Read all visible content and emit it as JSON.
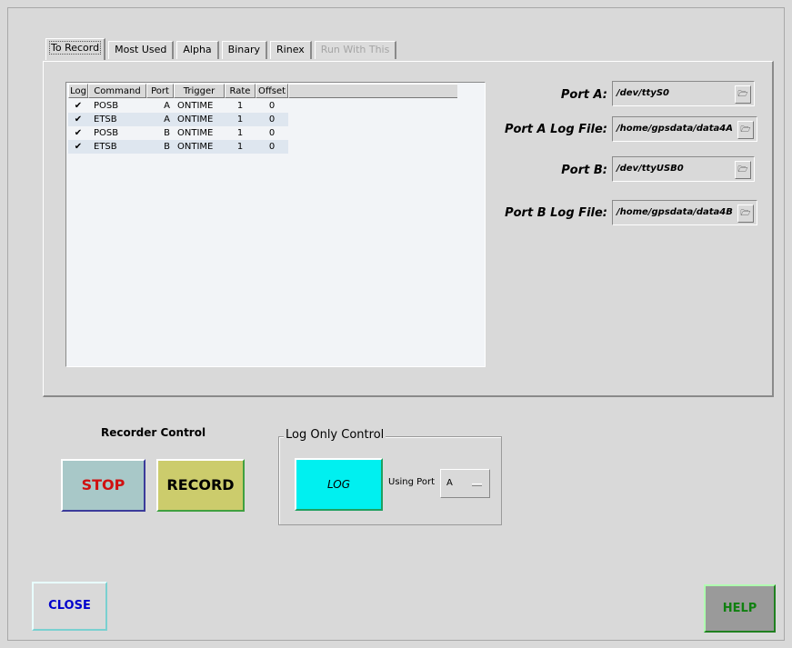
{
  "tabs": [
    {
      "label": "To Record"
    },
    {
      "label": "Most Used"
    },
    {
      "label": "Alpha"
    },
    {
      "label": "Binary"
    },
    {
      "label": "Rinex"
    },
    {
      "label": "Run With This"
    }
  ],
  "table": {
    "columns": [
      "Log",
      "Command",
      "Port",
      "Trigger",
      "Rate",
      "Offset"
    ],
    "rows": [
      {
        "log": "✔",
        "command": "POSB",
        "port": "A",
        "trigger": "ONTIME",
        "rate": "1",
        "offset": "0"
      },
      {
        "log": "✔",
        "command": "ETSB",
        "port": "A",
        "trigger": "ONTIME",
        "rate": "1",
        "offset": "0"
      },
      {
        "log": "✔",
        "command": "POSB",
        "port": "B",
        "trigger": "ONTIME",
        "rate": "1",
        "offset": "0"
      },
      {
        "log": "✔",
        "command": "ETSB",
        "port": "B",
        "trigger": "ONTIME",
        "rate": "1",
        "offset": "0"
      }
    ]
  },
  "fields": [
    {
      "label": "Port A:",
      "value": "/dev/ttyS0"
    },
    {
      "label": "Port A Log File:",
      "value": "/home/gpsdata/data4A"
    },
    {
      "label": "Port B:",
      "value": "/dev/ttyUSB0"
    },
    {
      "label": "Port B Log File:",
      "value": "/home/gpsdata/data4B"
    }
  ],
  "folder_icon_glyph": "🗁",
  "recorder": {
    "title": "Recorder Control",
    "stop": "STOP",
    "record": "RECORD"
  },
  "log_only": {
    "title": "Log Only Control",
    "log": "LOG",
    "using_port_label": "Using Port",
    "selected_port": "A"
  },
  "buttons": {
    "close": "CLOSE",
    "help": "HELP"
  },
  "colors": {
    "stop_text": "#d01010",
    "record_bg": "#cccc6c",
    "log_bg": "#00f0f0",
    "close_text": "#0000cc",
    "help_text": "#108010"
  }
}
